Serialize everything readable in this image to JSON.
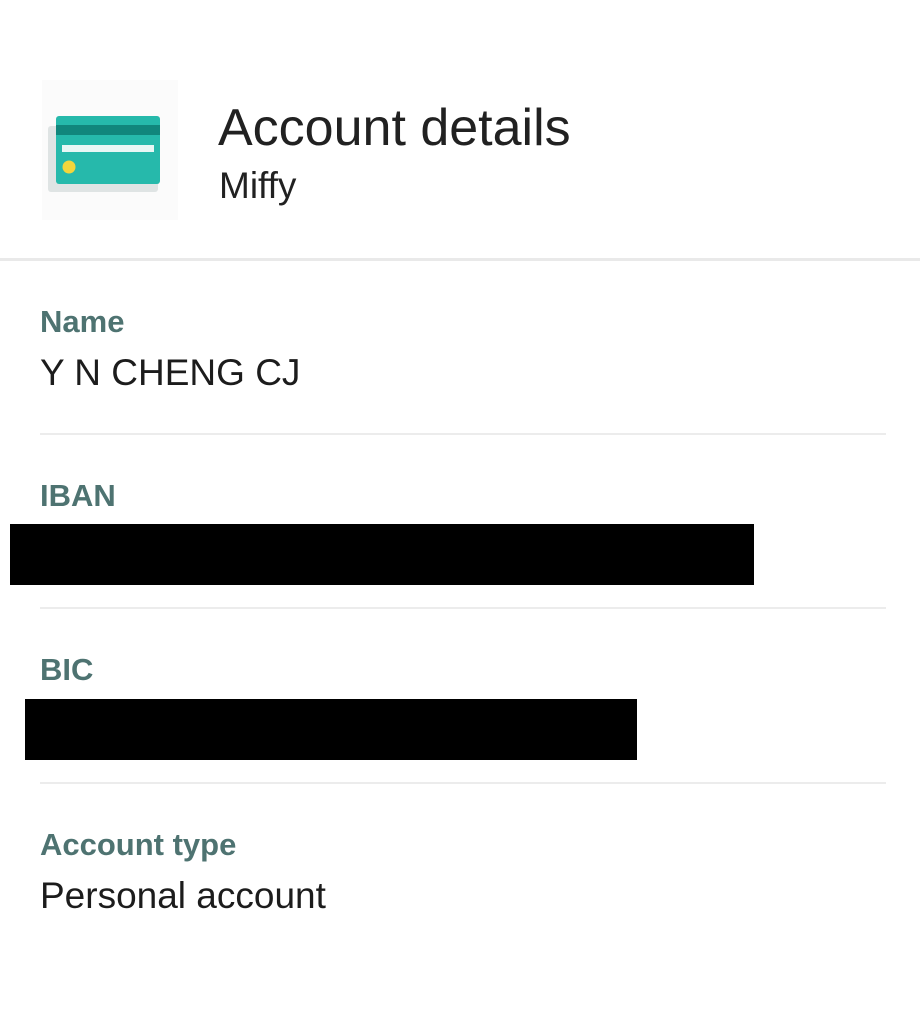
{
  "header": {
    "icon": "credit-card-icon",
    "title": "Account details",
    "subtitle": "Miffy"
  },
  "fields": {
    "name": {
      "label": "Name",
      "value": "Y N CHENG CJ"
    },
    "iban": {
      "label": "IBAN"
    },
    "bic": {
      "label": "BIC"
    },
    "account_type": {
      "label": "Account type",
      "value": "Personal account"
    }
  },
  "colors": {
    "card_teal": "#26b9ab",
    "card_stripe": "#0e6e68",
    "card_chip": "#f3d63c",
    "label_color": "#4e7371",
    "redaction": "#000000"
  }
}
